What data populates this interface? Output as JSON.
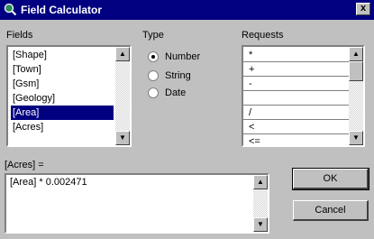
{
  "window": {
    "title": "Field Calculator",
    "close_glyph": "x"
  },
  "fields": {
    "label": "Fields",
    "items": [
      "[Shape]",
      "[Town]",
      "[Gsm]",
      "[Geology]",
      "[Area]",
      "[Acres]"
    ],
    "selected_index": 4
  },
  "type": {
    "label": "Type",
    "options": [
      "Number",
      "String",
      "Date"
    ],
    "selected": "Number"
  },
  "requests": {
    "label": "Requests",
    "items": [
      "*",
      "+",
      "-",
      "",
      "/",
      "<",
      "<="
    ]
  },
  "expression": {
    "label": "[Acres] =",
    "value": "[Area] * 0.002471"
  },
  "buttons": {
    "ok": "OK",
    "cancel": "Cancel"
  },
  "icons": {
    "app": "field-calculator-icon",
    "scroll_up": "arrow-up-icon",
    "scroll_down": "arrow-down-icon"
  }
}
